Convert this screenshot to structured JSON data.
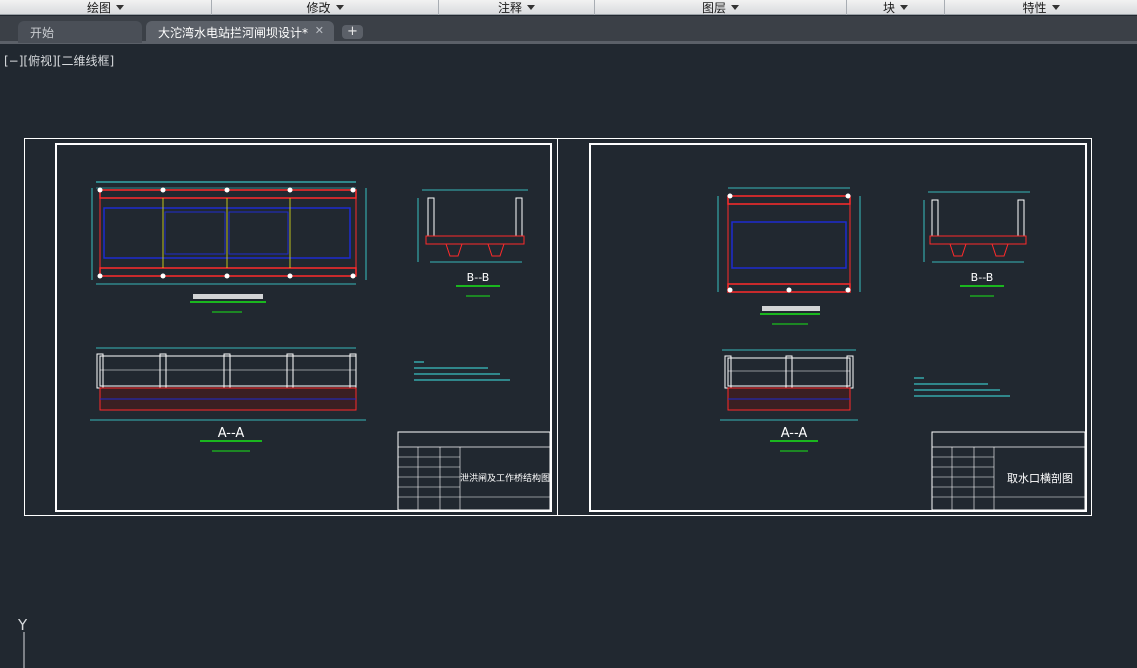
{
  "ribbon_panels": [
    {
      "label": "绘图"
    },
    {
      "label": "修改"
    },
    {
      "label": "注释"
    },
    {
      "label": "图层"
    },
    {
      "label": "块"
    },
    {
      "label": "特性"
    }
  ],
  "tabs": {
    "start": "开始",
    "active": "大沱湾水电站拦河闸坝设计*",
    "close_symbol": "✕",
    "new_tab_symbol": "+"
  },
  "viewport": {
    "controls": "[−][俯视][二维线框]"
  },
  "drawing": {
    "sheet1": {
      "section_b": "B--B",
      "section_a": "A--A",
      "title_block_title": "泄洪闸及工作桥结构图"
    },
    "sheet2": {
      "section_b": "B--B",
      "section_a": "A--A",
      "title_block_title": "取水口横剖图"
    }
  },
  "ucs": {
    "y_label": "Y"
  },
  "colors": {
    "background": "#212830",
    "sheet_border": "#ffffff",
    "red_line": "#ff2a2a",
    "blue_line": "#1e2bd0",
    "green_line": "#19e619",
    "cyan_line": "#3ee6e6",
    "yellow_line": "#e6e619"
  }
}
